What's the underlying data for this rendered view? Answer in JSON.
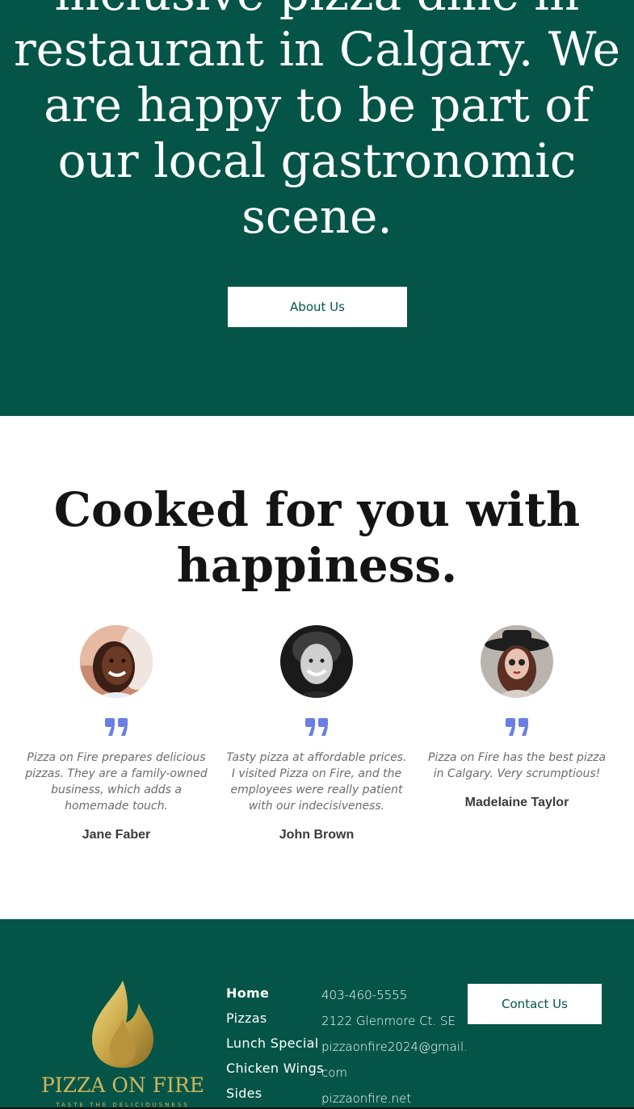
{
  "hero": {
    "heading_lines": [
      "inclusive pizza dine in",
      "restaurant in Calgary. We",
      "are happy to be part of",
      "our local gastronomic",
      "scene."
    ],
    "button_label": "About Us",
    "background_color": "#045548"
  },
  "testimonials": {
    "heading_lines": [
      "Cooked for you with",
      "happiness."
    ],
    "quote_icon_color": "#6a7ee6",
    "items": [
      {
        "quote": "Pizza on Fire prepares delicious pizzas. They are a family-owned business, which adds a homemade touch.",
        "name": "Jane Faber"
      },
      {
        "quote": "Tasty pizza at affordable prices. I visited Pizza on Fire, and the employees were really patient with our indecisiveness.",
        "name": "John Brown"
      },
      {
        "quote": "Pizza on Fire has the best pizza in Calgary. Very scrumptious!",
        "name": "Madelaine Taylor"
      }
    ]
  },
  "footer": {
    "logo": {
      "brand": "PIZZA ON FIRE",
      "tagline": "TASTE THE DELICIOUSNESS",
      "icon": "flame-icon",
      "color": "#d4b45a"
    },
    "nav": [
      "Home",
      "Pizzas",
      "Lunch Special",
      "Chicken Wings",
      "Sides"
    ],
    "active_nav": "Home",
    "contact": {
      "phone": "403-460-5555",
      "address": "2122 Glenmore Ct. SE",
      "email_line1": "pizzaonfire2024@gmail.",
      "email_line2": "com",
      "website": "pizzaonfire.net"
    },
    "contact_button_label": "Contact Us"
  }
}
